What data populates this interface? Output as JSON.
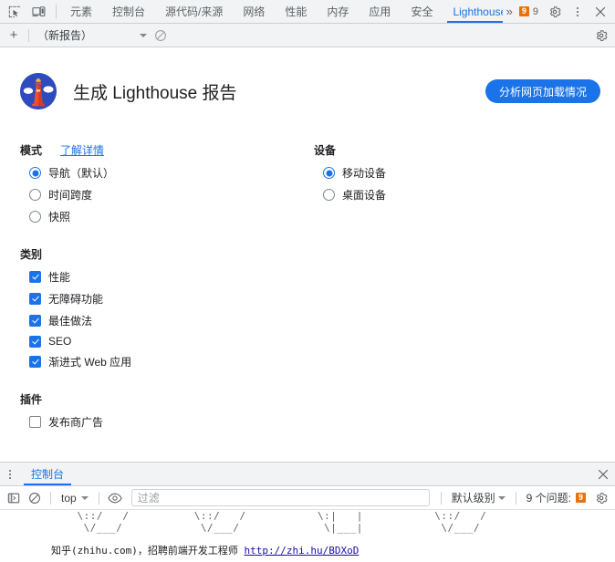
{
  "toolbar": {
    "inspect_icon": "inspect-element-icon",
    "device_icon": "device-toolbar-icon",
    "tabs": [
      {
        "label": "元素",
        "active": false
      },
      {
        "label": "控制台",
        "active": false
      },
      {
        "label": "源代码/来源",
        "active": false
      },
      {
        "label": "网络",
        "active": false
      },
      {
        "label": "性能",
        "active": false
      },
      {
        "label": "内存",
        "active": false
      },
      {
        "label": "应用",
        "active": false
      },
      {
        "label": "安全",
        "active": false
      },
      {
        "label": "Lighthouse",
        "active": true
      }
    ],
    "overflow_label": "»",
    "issue_badge_count": "9",
    "issue_count_label": "9",
    "settings_icon": "gear-icon",
    "more_icon": "kebab-menu-icon",
    "close_icon": "close-icon",
    "accent_color": "#1a73e8",
    "issue_color": "#e8710a"
  },
  "lighthouse_toolbar": {
    "add_label": "+",
    "report_select_value": "（新报告）",
    "clear_icon": "clear-icon",
    "settings_icon": "gear-icon"
  },
  "lighthouse": {
    "logo_name": "lighthouse-logo",
    "title": "生成 Lighthouse 报告",
    "analyze_button": "分析网页加载情况",
    "mode": {
      "title": "模式",
      "learn_more": "了解详情",
      "options": [
        {
          "label": "导航（默认）",
          "selected": true
        },
        {
          "label": "时间跨度",
          "selected": false
        },
        {
          "label": "快照",
          "selected": false
        }
      ]
    },
    "device": {
      "title": "设备",
      "options": [
        {
          "label": "移动设备",
          "selected": true
        },
        {
          "label": "桌面设备",
          "selected": false
        }
      ]
    },
    "categories": {
      "title": "类别",
      "options": [
        {
          "label": "性能",
          "checked": true
        },
        {
          "label": "无障碍功能",
          "checked": true
        },
        {
          "label": "最佳做法",
          "checked": true
        },
        {
          "label": "SEO",
          "checked": true
        },
        {
          "label": "渐进式 Web 应用",
          "checked": true
        }
      ]
    },
    "plugins": {
      "title": "插件",
      "options": [
        {
          "label": "发布商广告",
          "checked": false
        }
      ]
    }
  },
  "drawer": {
    "menu_icon": "kebab-menu-icon",
    "tab_label": "控制台",
    "close_icon": "close-icon",
    "sidebar_icon": "show-console-sidebar-icon",
    "clear_icon": "clear-console-icon",
    "context_value": "top",
    "eye_icon": "live-expression-icon",
    "filter_placeholder": "过滤",
    "filter_value": "",
    "level_label": "默认级别",
    "issues_label": "9 个问题:",
    "issues_badge": "9",
    "settings_icon": "gear-icon",
    "console_output": {
      "ascii_line_1": "    \\::/   /          \\::/   /           \\:|   |           \\::/   /",
      "ascii_line_2": "     \\/___/            \\/___/             \\|___|            \\/___/",
      "message_text": "知乎(zhihu.com)，招聘前端开发工程师 ",
      "message_link": "http://zhi.hu/BDXoD"
    }
  }
}
